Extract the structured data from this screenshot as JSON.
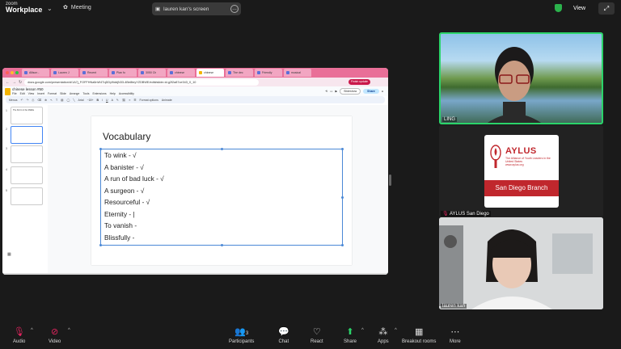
{
  "topbar": {
    "logo_line1": "zoom",
    "logo_line2": "Workplace",
    "meeting_label": "Meeting",
    "screen_share_label": "lauren kan's screen",
    "view_label": "View"
  },
  "browser": {
    "tabs": [
      "Allison -",
      "Lauren J",
      "Recent",
      "Plan fo",
      "3050 Ch",
      "chinese",
      "chinese",
      "The dec",
      "Friendly",
      "musical"
    ],
    "active_tab_index": 6,
    "url": "docs.google.com/presentation/d/1A7j_FOFFHNa5nW4TqDDy9iddjN33-4Be8teyYZDBWE/edit#slide=id.g2f2a87ce343_0_10",
    "finish_update": "Finish update",
    "doc_title": "chinese lesson #50",
    "menu": [
      "File",
      "Edit",
      "View",
      "Insert",
      "Format",
      "Slide",
      "Arrange",
      "Tools",
      "Extensions",
      "Help",
      "Accessibility"
    ],
    "slideshow_label": "Slideshow",
    "share_label": "Share",
    "toolbar_items": [
      "Menus",
      "Arial",
      "Format options",
      "Animate"
    ]
  },
  "slides": {
    "thumb_numbers": [
      "1",
      "2",
      "3",
      "4",
      "5"
    ],
    "thumb1_text": "The Kid in in the Middle",
    "slide_title": "Vocabulary",
    "vocab_items": [
      "To wink - √",
      "A banister - √",
      "A run of bad luck - √",
      "A surgeon - √",
      "Resourceful - √",
      "Eternity - |",
      "To vanish -",
      "Blissfully -"
    ]
  },
  "participants": [
    {
      "name": "LING",
      "speaking": true
    },
    {
      "name": "AYLUS San Diego",
      "speaking": false,
      "card_title": "AYLUS",
      "card_sub": "The Alliance of Youth Leaders in the United States",
      "card_url": "www.aylus.org",
      "card_branch": "San Diego Branch"
    },
    {
      "name": "lauren kan",
      "speaking": false
    }
  ],
  "controls": {
    "audio": "Audio",
    "video": "Video",
    "participants": "Participants",
    "participants_count": "3",
    "chat": "Chat",
    "react": "React",
    "share": "Share",
    "apps": "Apps",
    "breakout": "Breakout rooms",
    "more": "More"
  },
  "colors": {
    "share_green": "#2bd46a",
    "mute_red": "#e0245e",
    "tab_pink": "#e96f98",
    "aylus_red": "#c0272d"
  }
}
